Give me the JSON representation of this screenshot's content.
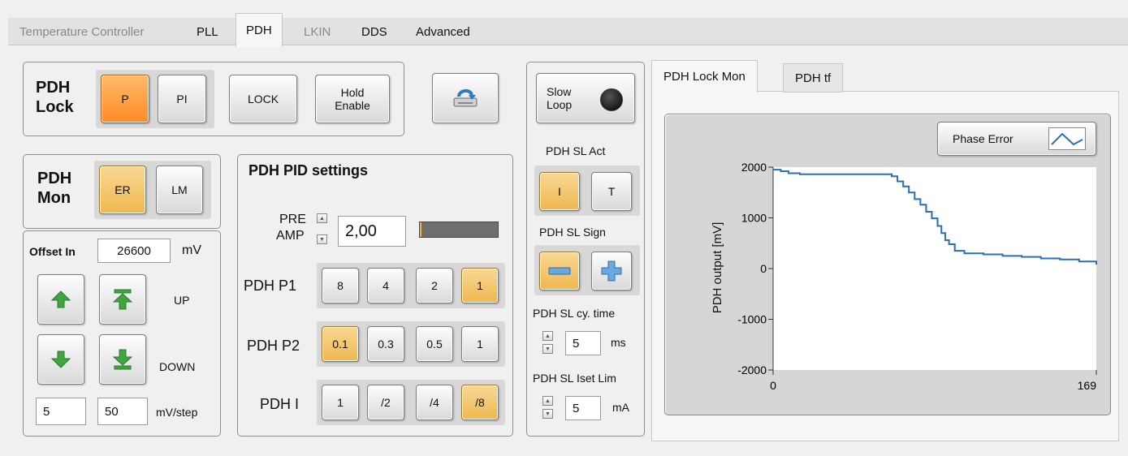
{
  "tabs": [
    {
      "label": "Temperature Controller",
      "state": "disabled"
    },
    {
      "label": "PLL",
      "state": "normal"
    },
    {
      "label": "PDH",
      "state": "active"
    },
    {
      "label": "LKIN",
      "state": "disabled"
    },
    {
      "label": "DDS",
      "state": "normal"
    },
    {
      "label": "Advanced",
      "state": "normal"
    }
  ],
  "lock": {
    "title_line1": "PDH",
    "title_line2": "Lock",
    "p_label": "P",
    "pi_label": "PI",
    "lock_label": "LOCK",
    "hold_line1": "Hold",
    "hold_line2": "Enable",
    "selected": "P"
  },
  "mon": {
    "title_line1": "PDH",
    "title_line2": "Mon",
    "er_label": "ER",
    "lm_label": "LM",
    "selected": "ER"
  },
  "offset": {
    "label": "Offset In",
    "value": "26600",
    "unit": "mV",
    "up_label": "UP",
    "down_label": "DOWN",
    "step_small": "5",
    "step_large": "50",
    "step_unit": "mV/step"
  },
  "pid": {
    "title": "PDH PID settings",
    "pre_label": "PRE",
    "amp_label": "AMP",
    "preamp_value": "2,00",
    "preamp_level": 0.02,
    "p1_label": "PDH P1",
    "p1_options": [
      "8",
      "4",
      "2",
      "1"
    ],
    "p1_selected": "1",
    "p2_label": "PDH P2",
    "p2_options": [
      "0.1",
      "0.3",
      "0.5",
      "1"
    ],
    "p2_selected": "0.1",
    "i_label": "PDH I",
    "i_options": [
      "1",
      "/2",
      "/4",
      "/8"
    ],
    "i_selected": "/8"
  },
  "slow_loop": {
    "line1": "Slow",
    "line2": "Loop",
    "act_label": "PDH SL Act",
    "act_i": "I",
    "act_t": "T",
    "act_selected": "I",
    "sign_label": "PDH SL Sign",
    "sign_selected": "minus",
    "cytime_label": "PDH SL cy. time",
    "cytime_value": "5",
    "cytime_unit": "ms",
    "iset_label": "PDH SL Iset Lim",
    "iset_value": "5",
    "iset_unit": "mA"
  },
  "right_tabs": [
    {
      "label": "PDH Lock Mon",
      "state": "active"
    },
    {
      "label": "PDH tf",
      "state": "normal"
    }
  ],
  "chart_data": {
    "type": "line",
    "legend_label": "Phase Error",
    "ylabel": "PDH output [mV]",
    "xlabel": "",
    "xlim": [
      0,
      169
    ],
    "ylim": [
      -2000,
      2000
    ],
    "x_ticks": [
      "0",
      "169"
    ],
    "y_ticks": [
      "2000",
      "1000",
      "0",
      "-1000",
      "-2000"
    ],
    "series": [
      {
        "name": "Phase Error",
        "color": "#2a6fb5",
        "x": [
          0,
          4,
          8,
          14,
          20,
          30,
          40,
          50,
          58,
          62,
          65,
          68,
          71,
          74,
          77,
          80,
          83,
          86,
          88,
          90,
          92,
          95,
          100,
          110,
          120,
          130,
          140,
          150,
          160,
          169
        ],
        "y": [
          1950,
          1920,
          1880,
          1860,
          1860,
          1860,
          1860,
          1860,
          1860,
          1820,
          1720,
          1620,
          1500,
          1370,
          1260,
          1120,
          990,
          840,
          700,
          560,
          480,
          350,
          300,
          280,
          250,
          230,
          200,
          180,
          140,
          80
        ]
      }
    ]
  },
  "colors": {
    "accent_on": "#efb74f",
    "accent_orange": "#ff8a26",
    "series": "#2a6fb5"
  }
}
